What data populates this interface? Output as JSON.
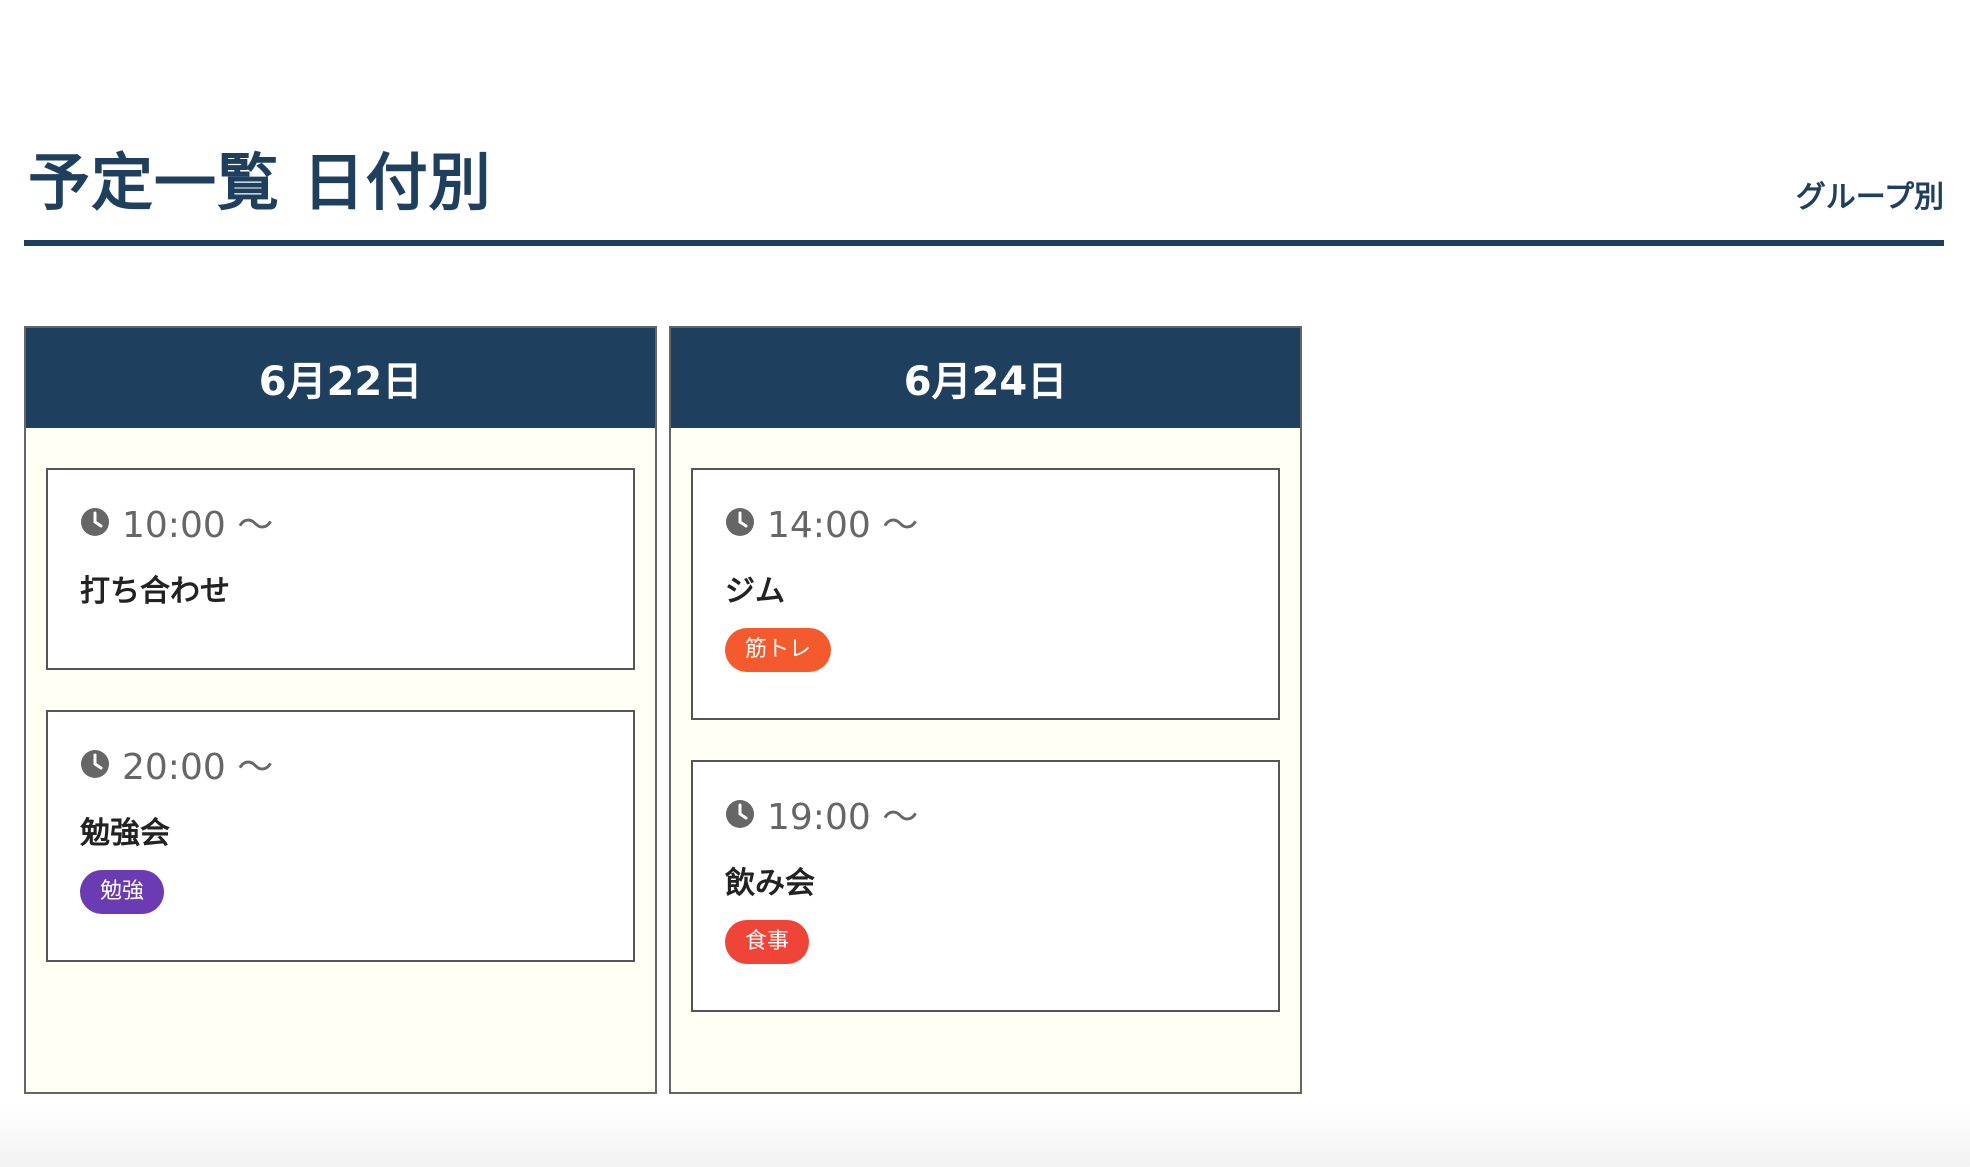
{
  "header": {
    "title": "予定一覧 日付別",
    "group_link_label": "グループ別"
  },
  "days": [
    {
      "date": "6月22日",
      "events": [
        {
          "time": "10:00 〜",
          "title": "打ち合わせ",
          "tag": null
        },
        {
          "time": "20:00 〜",
          "title": "勉強会",
          "tag": {
            "label": "勉強",
            "color": "#6a3bb2"
          }
        }
      ]
    },
    {
      "date": "6月24日",
      "events": [
        {
          "time": "14:00 〜",
          "title": "ジム",
          "tag": {
            "label": "筋トレ",
            "color": "#f45a2e"
          }
        },
        {
          "time": "19:00 〜",
          "title": "飲み会",
          "tag": {
            "label": "食事",
            "color": "#ee4538"
          }
        }
      ]
    }
  ],
  "icons": {
    "time_icon": "clock-icon"
  },
  "colors": {
    "primary": "#1f3f5e",
    "column_background": "#fffff3",
    "time_text": "#666666"
  }
}
